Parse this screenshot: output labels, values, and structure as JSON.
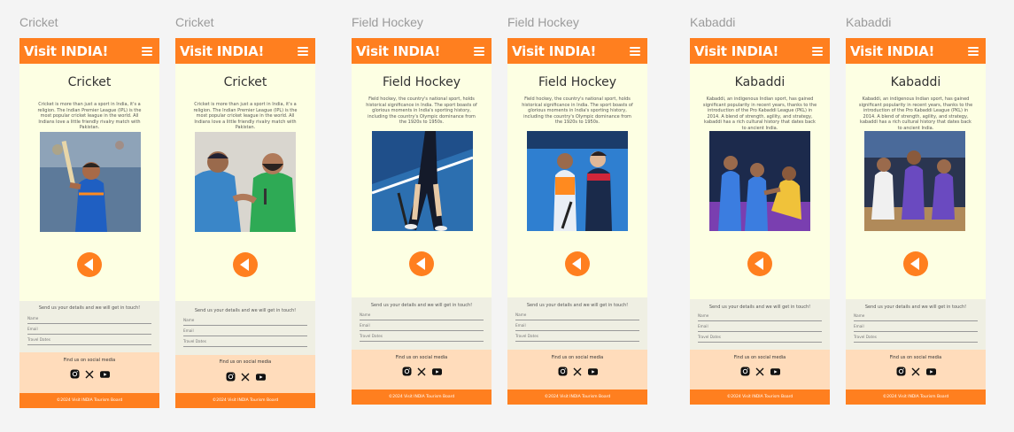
{
  "frames": [
    {
      "label": "Cricket"
    },
    {
      "label": "Cricket"
    },
    {
      "label": "Field Hockey"
    },
    {
      "label": "Field Hockey"
    },
    {
      "label": "Kabaddi"
    },
    {
      "label": "Kabaddi"
    }
  ],
  "header": {
    "brand": "Visit INDIA!",
    "menu_icon": "hamburger-menu-icon"
  },
  "sports": {
    "cricket": {
      "title": "Cricket",
      "text": "Cricket is more than just a sport in India, it's a religion. The Indian Premier League (IPL) is the most popular cricket league in the world. All Indians love a little friendly rivalry match with Pakistan."
    },
    "hockey": {
      "title": "Field Hockey",
      "text": "Field hockey, the country's national sport, holds historical significance in India. The sport boasts of glorious moments in India's sporting history, including the country's Olympic dominance from the 1920s to 1950s."
    },
    "kabaddi": {
      "title": "Kabaddi",
      "text": "Kabaddi, an indigenous Indian sport, has gained significant popularity in recent years, thanks to the introduction of the Pro Kabaddi League (PKL) in 2014. A blend of strength, agility, and strategy, kabaddi has a rich cultural history that dates back to ancient India."
    }
  },
  "back_button": {
    "icon": "back-arrow-icon"
  },
  "contact": {
    "title": "Send us your details and we will get in touch!",
    "fields": {
      "name": "Name",
      "email": "Email",
      "dates": "Travel Dates"
    }
  },
  "social": {
    "title": "Find us on social media",
    "icons": [
      "instagram-icon",
      "x-icon",
      "youtube-icon"
    ]
  },
  "footer": {
    "text": "©2024 Visit INDIA Tourism Board"
  },
  "colors": {
    "accent": "#ff7f1f",
    "page_bg": "#fdffe3",
    "form_bg": "#efefe3",
    "social_bg": "#ffdcbb"
  }
}
